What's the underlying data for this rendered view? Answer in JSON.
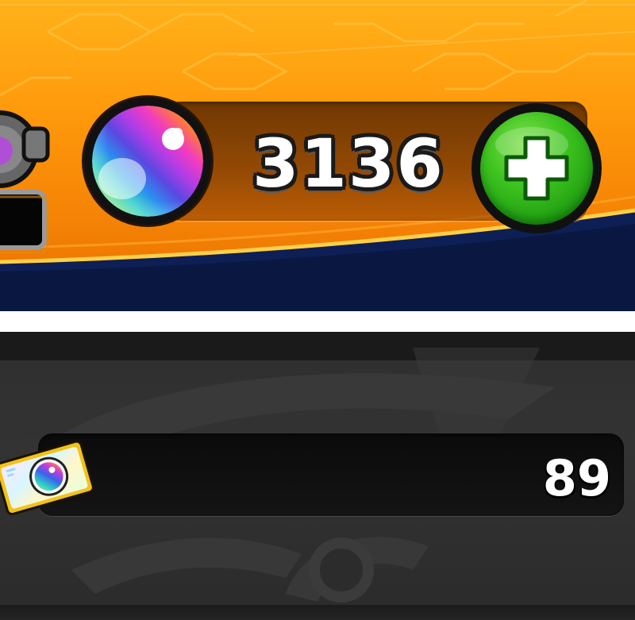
{
  "currency_header": {
    "orb_count": "3136",
    "orb_icon": "rainbow-orb-icon",
    "add_button_icon": "plus-icon",
    "accent_color": "#ff9a0c",
    "button_color": "#3cc21e"
  },
  "ticket_panel": {
    "ticket_count": "89",
    "ticket_icon": "orb-ticket-icon",
    "background_color": "#2f2f2f"
  }
}
